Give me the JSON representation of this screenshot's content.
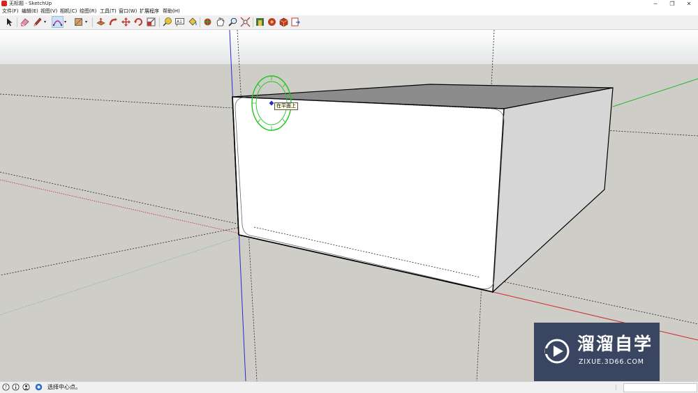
{
  "window": {
    "title": "无标题 - SketchUp",
    "minimize_glyph": "─",
    "restore_glyph": "❐",
    "close_glyph": "✕"
  },
  "menu": [
    "文件(F)",
    "编辑(E)",
    "视图(V)",
    "相机(C)",
    "绘图(R)",
    "工具(T)",
    "窗口(W)",
    "扩展程序",
    "帮助(H)"
  ],
  "toolbar": {
    "tools": [
      "select-icon",
      "eraser-icon",
      "pencil-icon",
      "arc-icon",
      "rectangle-icon",
      "push-pull-icon",
      "follow-me-icon",
      "move-icon",
      "rotate-icon",
      "scale-icon",
      "tape-measure-icon",
      "text-icon",
      "paint-bucket-icon",
      "orbit-icon",
      "pan-icon",
      "zoom-icon",
      "zoom-extents-icon",
      "warehouse-icon",
      "extension-warehouse-icon",
      "components-icon",
      "send-to-layout-icon"
    ],
    "dropdown_glyph": "▾",
    "active_tool": "arc-icon"
  },
  "viewport": {
    "tooltip": "在平面上",
    "sky_color": "#f1f2f2",
    "ground_color": "#cfcdc8",
    "axis_colors": {
      "red": "#cc2a2a",
      "green": "#2ab02a",
      "blue": "#2a2ad2"
    },
    "cursor_color": "#1fc41f"
  },
  "status": {
    "text": "选择中心点。",
    "icons": [
      "help-icon",
      "info-icon",
      "user-icon",
      "geo-icon"
    ]
  },
  "watermark": {
    "name": "溜溜自学",
    "url": "ZIXUE.3D66.COM",
    "bg_color": "#3a4661"
  }
}
